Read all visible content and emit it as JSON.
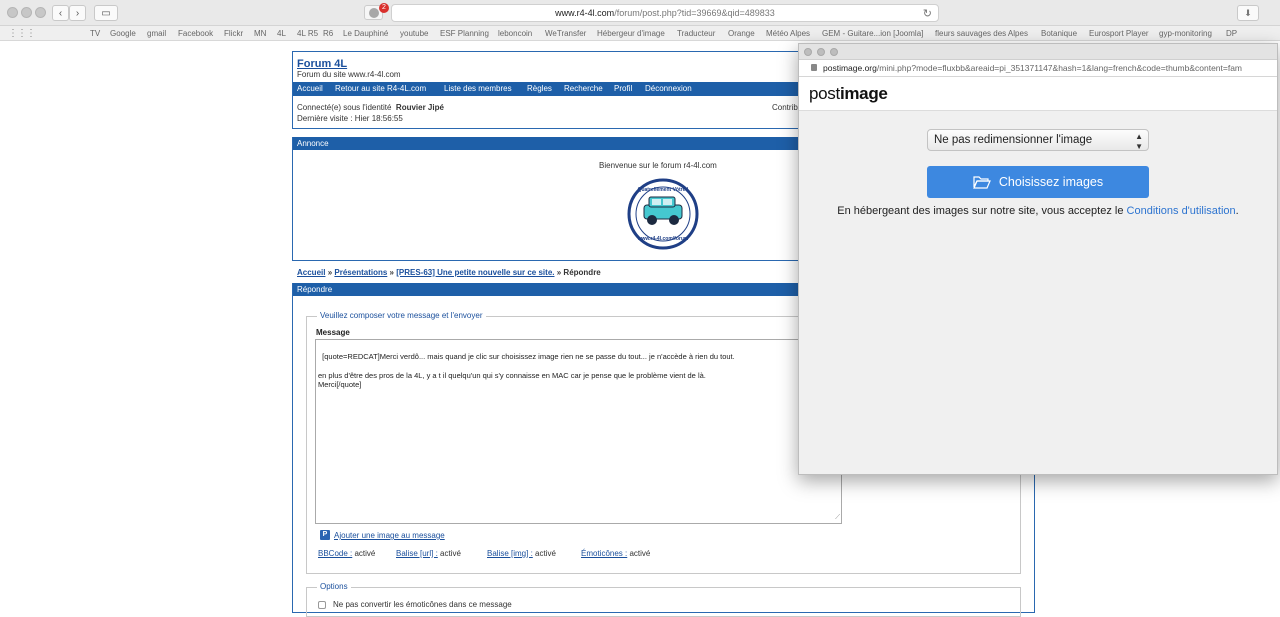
{
  "browser": {
    "url_host": "www.r4-4l.com",
    "url_path": "/forum/post.php?tid=39669&qid=489833",
    "extension_badge": "2",
    "bookmarks": [
      "TV",
      "Google",
      "gmail",
      "Facebook",
      "Flickr",
      "MN",
      "4L",
      "4L R5",
      "R6",
      "Le Dauphiné",
      "youtube",
      "ESF Planning",
      "leboncoin",
      "WeTransfer",
      "Hébergeur d'image",
      "Traducteur",
      "Orange",
      "Météo Alpes",
      "GEM - Guitare...ion [Joomla]",
      "fleurs sauvages des Alpes",
      "Botanique",
      "Eurosport Player",
      "gyp-monitoring",
      "DP"
    ]
  },
  "forum": {
    "title": "Forum 4L",
    "subtitle": "Forum du site www.r4-4l.com",
    "nav": [
      "Accueil",
      "Retour au site R4-4L.com",
      "Liste des membres",
      "Règles",
      "Recherche",
      "Profil",
      "Déconnexion"
    ],
    "connected_label": "Connecté(e) sous l'identité",
    "username": "Rouvier Jipé",
    "last_visit": "Dernière visite : Hier 18:56:55",
    "right_text": "Contrib",
    "announce_title": "Annonce",
    "announce_text": "Bienvenue sur le forum r4-4l.com",
    "logo_text_top": "Quatrellement Vôtre !",
    "logo_text_bottom": "www.r4-4l.com/forum",
    "breadcrumb": {
      "home": "Accueil",
      "sep": "»",
      "section": "Présentations",
      "topic": "[PRES-63] Une petite nouvelle sur ce site.",
      "current": "Répondre"
    },
    "reply_header": "Répondre",
    "compose_legend": "Veuillez composer votre message et l'envoyer",
    "message_label": "Message",
    "message_body": "[quote=REDCAT]Merci verdô... mais quand je clic sur choisissez image rien ne se passe du tout... je n'accède à rien du tout.\n\nen plus d'être des pros de la 4L, y a t il quelqu'un qui s'y connaisse en MAC car je pense que le problème vient de là.\nMerci[/quote]",
    "add_image_link": "Ajouter une image au message",
    "bbcode_link": "BBCode :",
    "bbcode_state": "activé",
    "url_link": "Balise [url] :",
    "url_state": "activé",
    "img_link": "Balise [img] :",
    "img_state": "activé",
    "emoticons_link": "Émoticônes :",
    "emoticons_state": "activé",
    "options_legend": "Options",
    "option_1": "Ne pas convertir les émoticônes dans ce message"
  },
  "popup": {
    "url_host": "postimage.org",
    "url_path": "/mini.php?mode=fluxbb&areaid=pi_351371147&hash=1&lang=french&code=thumb&content=fam",
    "logo_post": "post",
    "logo_image": "image",
    "resize_select": "Ne pas redimensionner l'image",
    "choose_button": "Choisissez images",
    "terms_prefix": "En hébergeant des images sur notre site, vous acceptez le",
    "terms_link": "Conditions d'utilisation",
    "terms_suffix": "."
  },
  "colors": {
    "forum_blue": "#1e5fa8",
    "postimage_button": "#3d88e0",
    "badge_red": "#d9302c"
  }
}
